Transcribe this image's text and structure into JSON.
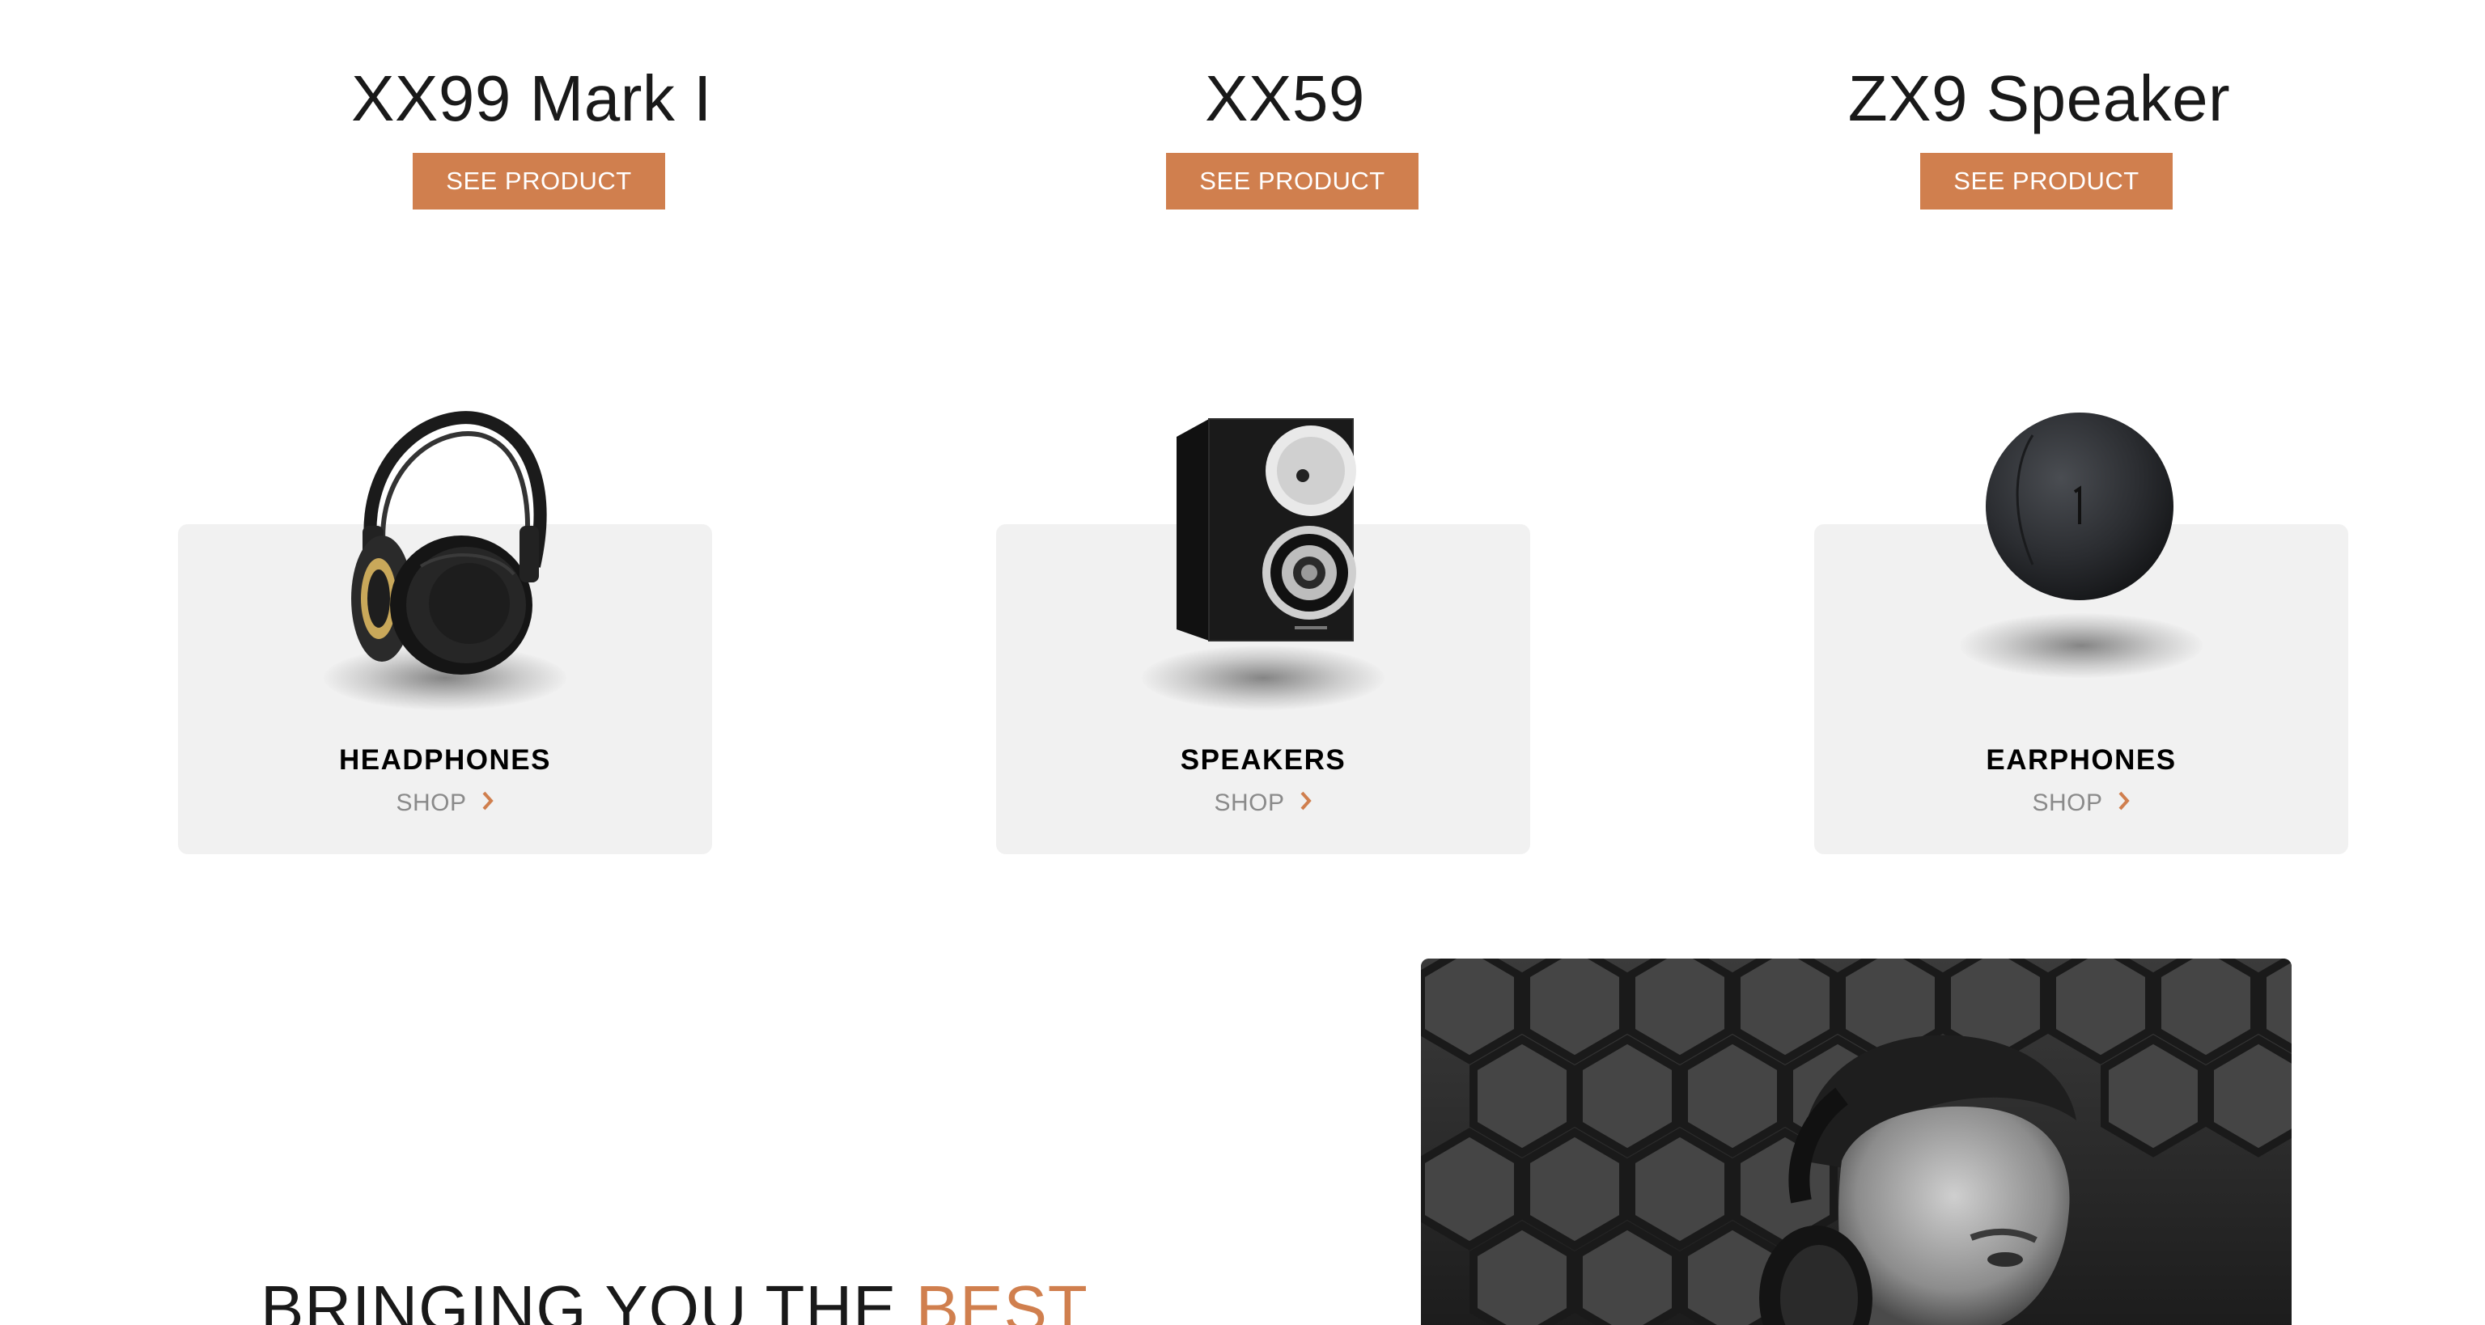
{
  "products": [
    {
      "title": "XX99 Mark I",
      "button": "SEE PRODUCT"
    },
    {
      "title": "XX59",
      "button": "SEE PRODUCT"
    },
    {
      "title": "ZX9 Speaker",
      "button": "SEE PRODUCT"
    }
  ],
  "categories": [
    {
      "name": "HEADPHONES",
      "shop": "SHOP",
      "image": "headphones-image",
      "chevron": "chevron-right-icon"
    },
    {
      "name": "SPEAKERS",
      "shop": "SHOP",
      "image": "speaker-image",
      "chevron": "chevron-right-icon"
    },
    {
      "name": "EARPHONES",
      "shop": "SHOP",
      "image": "earphones-image",
      "chevron": "chevron-right-icon"
    }
  ],
  "about": {
    "heading_start": "BRINGING YOU THE ",
    "heading_accent": "BEST",
    "image": "man-with-headphones-photo"
  },
  "colors": {
    "accent": "#d07f4e",
    "card_bg": "#f1f1f1",
    "text_dark": "#191919",
    "text_muted": "#8a8a8a"
  }
}
